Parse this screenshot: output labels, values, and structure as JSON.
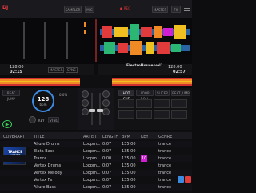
{
  "topbar": {
    "logo": "DJ",
    "btn_a": "SAMPLER",
    "btn_b": "MIC",
    "rec": "● REC",
    "master": "MASTER",
    "btn_c": "FX"
  },
  "deck_left": {
    "bpm": "128.00",
    "time": "02:15",
    "tag1": "MASTER",
    "tag2": "SYNC",
    "beat_jump": "BEAT JUMP",
    "tempo": "128",
    "tempo_unit": "bpm",
    "pitch": "0.0%",
    "key_label": "KEY",
    "loop_a": "SYNC",
    "play_label": "▶",
    "cue_label": "CUE"
  },
  "deck_right": {
    "title": "ElectroHouse vol1",
    "bpm": "128.00",
    "time": "02:57",
    "hot_cue": "HOT CUE",
    "loop_roll": "LOOP ROLL",
    "slicer": "SLICER",
    "beat_jump": "BEAT JUMP"
  },
  "browser": {
    "columns": [
      "COVERART",
      "TITLE",
      "ARTIST",
      "LENGTH",
      "BPM",
      "KEY",
      "GENRE"
    ],
    "rows": [
      {
        "title": "Allure Drums",
        "artist": "Loopm...",
        "length": "0:07",
        "bpm": "135.00",
        "key": "",
        "genre": "trance"
      },
      {
        "title": "Elata Bass",
        "artist": "Loopm...",
        "length": "0:07",
        "bpm": "135.00",
        "key": "",
        "genre": "trance"
      },
      {
        "title": "Trance",
        "artist": "Loopm...",
        "length": "0:00",
        "bpm": "135.00",
        "key": "10",
        "genre": "trance"
      },
      {
        "title": "Vertex Drums",
        "artist": "Loopm...",
        "length": "0:07",
        "bpm": "135.00",
        "key": "",
        "genre": "trance"
      },
      {
        "title": "Vertex Melody",
        "artist": "Loopm...",
        "length": "0:07",
        "bpm": "135.00",
        "key": "",
        "genre": "trance"
      },
      {
        "title": "Vertex Fx",
        "artist": "Loopm...",
        "length": "0:07",
        "bpm": "135.00",
        "key": "",
        "genre": "trance"
      },
      {
        "title": "Allure Bass",
        "artist": "Loopm...",
        "length": "0:07",
        "bpm": "135.00",
        "key": "",
        "genre": "trance"
      }
    ],
    "cover_text": "TRANCE\nVIBES"
  },
  "colors": {
    "accent_red": "#e23b3b",
    "accent_orange": "#f08a24",
    "accent_blue": "#3b8be2",
    "key_magenta": "#d01fd0"
  }
}
